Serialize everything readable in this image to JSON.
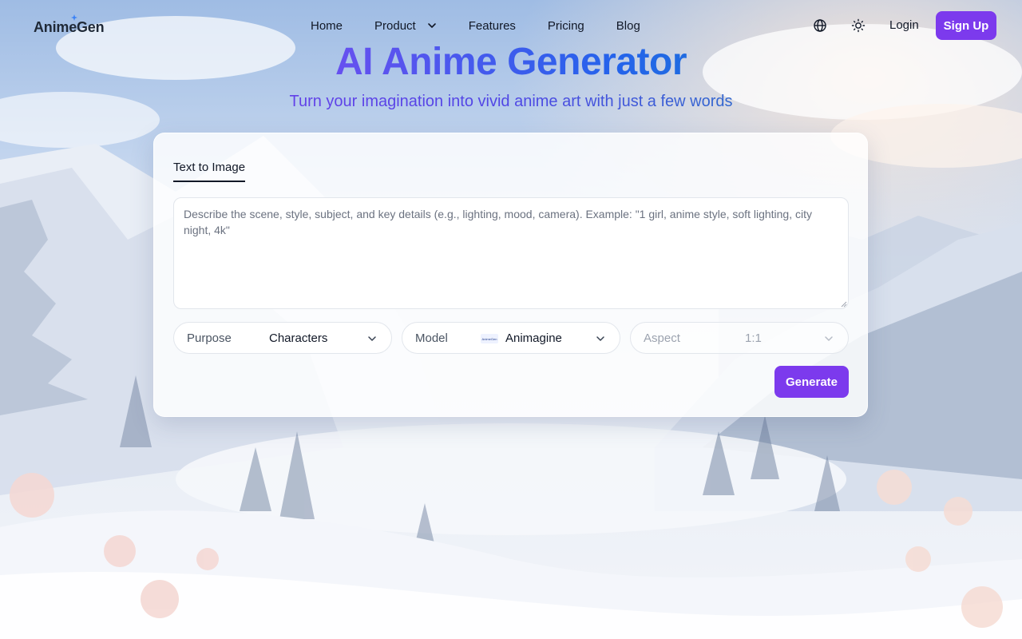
{
  "header": {
    "logo": "AnimeGen",
    "nav": [
      {
        "label": "Home"
      },
      {
        "label": "Product",
        "icon": "chevron-down-icon"
      },
      {
        "label": "Features"
      },
      {
        "label": "Pricing"
      },
      {
        "label": "Blog"
      }
    ],
    "icons": [
      "globe-icon",
      "sun-icon"
    ],
    "login_label": "Login",
    "signup_label": "Sign Up"
  },
  "hero": {
    "title": "AI Anime Generator",
    "subtitle": "Turn your imagination into vivid anime art with just a few words"
  },
  "generator": {
    "tab_label": "Text to Image",
    "prompt": {
      "value": "",
      "placeholder": "Describe the scene, style, subject, and key details (e.g., lighting, mood, camera). Example: \"1 girl, anime style, soft lighting, city night, 4k\""
    },
    "purpose": {
      "label": "Purpose",
      "value": "Characters"
    },
    "model": {
      "label": "Model",
      "value": "Animagine",
      "logo_text": "AnimeGen"
    },
    "aspect": {
      "label": "Aspect",
      "value": "1:1"
    },
    "generate_label": "Generate"
  },
  "colors": {
    "accent": "#7c3aed",
    "title_gradient": [
      "#7c3aed",
      "#2563eb",
      "#0891b2"
    ]
  }
}
